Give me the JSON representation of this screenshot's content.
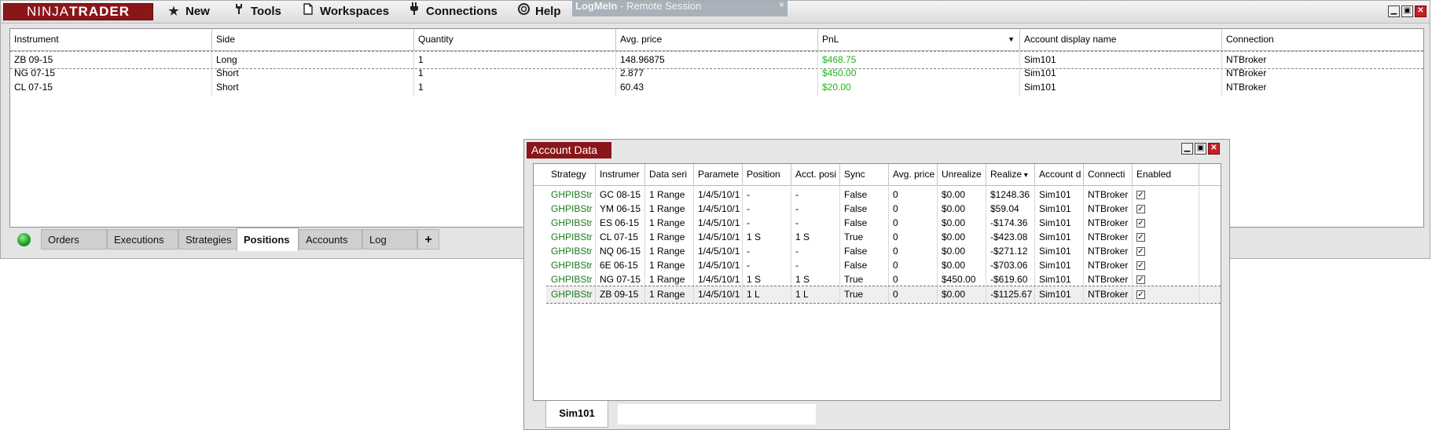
{
  "app": {
    "logo": "NINJATRADER",
    "menu": [
      {
        "label": "New",
        "icon": "star-icon"
      },
      {
        "label": "Tools",
        "icon": "wrench-icon"
      },
      {
        "label": "Workspaces",
        "icon": "document-icon"
      },
      {
        "label": "Connections",
        "icon": "plug-icon"
      },
      {
        "label": "Help",
        "icon": "lifebuoy-icon"
      }
    ],
    "overlay": {
      "brand": "LogMeIn",
      "separator": " - ",
      "text": "Remote Session",
      "close": "×"
    }
  },
  "positions": {
    "columns": [
      "Instrument",
      "Side",
      "Quantity",
      "Avg. price",
      "PnL",
      "Account display name",
      "Connection"
    ],
    "rows": [
      {
        "instrument": "ZB 09-15",
        "side": "Long",
        "quantity": "1",
        "avg_price": "148.96875",
        "pnl": "$468.75",
        "account": "Sim101",
        "connection": "NTBroker"
      },
      {
        "instrument": "NG 07-15",
        "side": "Short",
        "quantity": "1",
        "avg_price": "2.877",
        "pnl": "$450.00",
        "account": "Sim101",
        "connection": "NTBroker"
      },
      {
        "instrument": "CL 07-15",
        "side": "Short",
        "quantity": "1",
        "avg_price": "60.43",
        "pnl": "$20.00",
        "account": "Sim101",
        "connection": "NTBroker"
      }
    ],
    "pnl_color": "#1fb41f"
  },
  "tabs": {
    "items": [
      "Orders",
      "Executions",
      "Strategies",
      "Positions",
      "Accounts",
      "Log"
    ],
    "active": "Positions",
    "add": "+"
  },
  "account_data": {
    "title": "Account Data",
    "columns": [
      "Strategy",
      "Instrumer",
      "Data seri",
      "Paramete",
      "Position",
      "Acct. posi",
      "Sync",
      "Avg. price",
      "Unrealize",
      "Realize",
      "Account d",
      "Connecti",
      "Enabled"
    ],
    "rows": [
      {
        "strategy": "GHPIBStr",
        "instrument": "GC 08-15",
        "data_series": "1 Range",
        "parameters": "1/4/5/10/1",
        "position": "-",
        "acct_position": "-",
        "sync": "False",
        "avg_price": "0",
        "unrealized": "$0.00",
        "realized": "$1248.36",
        "account": "Sim101",
        "connection": "NTBroker",
        "enabled": true
      },
      {
        "strategy": "GHPIBStr",
        "instrument": "YM 06-15",
        "data_series": "1 Range",
        "parameters": "1/4/5/10/1",
        "position": "-",
        "acct_position": "-",
        "sync": "False",
        "avg_price": "0",
        "unrealized": "$0.00",
        "realized": "$59.04",
        "account": "Sim101",
        "connection": "NTBroker",
        "enabled": true
      },
      {
        "strategy": "GHPIBStr",
        "instrument": "ES 06-15",
        "data_series": "1 Range",
        "parameters": "1/4/5/10/1",
        "position": "-",
        "acct_position": "-",
        "sync": "False",
        "avg_price": "0",
        "unrealized": "$0.00",
        "realized": "-$174.36",
        "account": "Sim101",
        "connection": "NTBroker",
        "enabled": true
      },
      {
        "strategy": "GHPIBStr",
        "instrument": "CL 07-15",
        "data_series": "1 Range",
        "parameters": "1/4/5/10/1",
        "position": "1 S",
        "acct_position": "1 S",
        "sync": "True",
        "avg_price": "0",
        "unrealized": "$0.00",
        "realized": "-$423.08",
        "account": "Sim101",
        "connection": "NTBroker",
        "enabled": true
      },
      {
        "strategy": "GHPIBStr",
        "instrument": "NQ 06-15",
        "data_series": "1 Range",
        "parameters": "1/4/5/10/1",
        "position": "-",
        "acct_position": "-",
        "sync": "False",
        "avg_price": "0",
        "unrealized": "$0.00",
        "realized": "-$271.12",
        "account": "Sim101",
        "connection": "NTBroker",
        "enabled": true
      },
      {
        "strategy": "GHPIBStr",
        "instrument": "6E 06-15",
        "data_series": "1 Range",
        "parameters": "1/4/5/10/1",
        "position": "-",
        "acct_position": "-",
        "sync": "False",
        "avg_price": "0",
        "unrealized": "$0.00",
        "realized": "-$703.06",
        "account": "Sim101",
        "connection": "NTBroker",
        "enabled": true
      },
      {
        "strategy": "GHPIBStr",
        "instrument": "NG 07-15",
        "data_series": "1 Range",
        "parameters": "1/4/5/10/1",
        "position": "1 S",
        "acct_position": "1 S",
        "sync": "True",
        "avg_price": "0",
        "unrealized": "$450.00",
        "realized": "-$619.60",
        "account": "Sim101",
        "connection": "NTBroker",
        "enabled": true
      },
      {
        "strategy": "GHPIBStr",
        "instrument": "ZB 09-15",
        "data_series": "1 Range",
        "parameters": "1/4/5/10/1",
        "position": "1 L",
        "acct_position": "1 L",
        "sync": "True",
        "avg_price": "0",
        "unrealized": "$0.00",
        "realized": "-$1125.67",
        "account": "Sim101",
        "connection": "NTBroker",
        "enabled": true
      }
    ],
    "tab": "Sim101",
    "strategy_color": "#1c7a1c"
  }
}
